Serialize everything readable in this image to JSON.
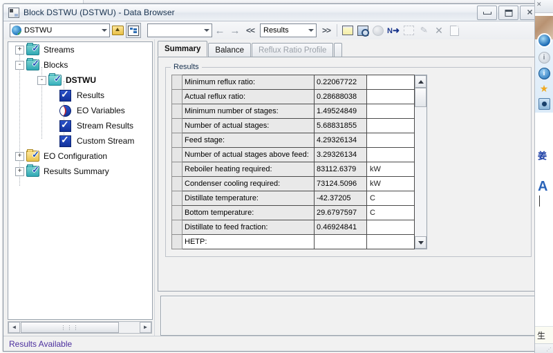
{
  "window": {
    "title": "Block DSTWU (DSTWU) - Data Browser",
    "icon": "application-icon",
    "minimize_label": "",
    "maximize_label": "",
    "close_label": "✕"
  },
  "toolbar": {
    "object_combo_value": "DSTWU",
    "object_combo_icon": "block-object-icon",
    "blank_combo_value": "",
    "folder_up_label": "folder-up-icon",
    "tree_toggle_label": "tree-view-icon",
    "back_arrow": "←",
    "forward_arrow": "→",
    "prev_chevrons": "<<",
    "next_chevrons": ">>",
    "form_combo_value": "Results",
    "icons": [
      {
        "name": "yellow-pane-icon",
        "label": ""
      },
      {
        "name": "magnify-input-icon",
        "label": ""
      },
      {
        "name": "globe-icon",
        "label": ""
      },
      {
        "name": "next-input-icon",
        "label": "N"
      },
      {
        "name": "dashed-box-icon",
        "label": ""
      },
      {
        "name": "pencil-icon",
        "label": "✎"
      },
      {
        "name": "delete-x-icon",
        "label": "✕"
      },
      {
        "name": "document-icon",
        "label": ""
      }
    ]
  },
  "tree": {
    "nodes": [
      {
        "label": "Streams",
        "icon": "folder-check-teal",
        "expander": "+",
        "indent": 0,
        "bold": false
      },
      {
        "label": "Blocks",
        "icon": "folder-check-teal",
        "expander": "-",
        "indent": 0,
        "bold": false
      },
      {
        "label": "DSTWU",
        "icon": "folder-check-teal",
        "expander": "-",
        "indent": 1,
        "bold": true
      },
      {
        "label": "Results",
        "icon": "blue-check",
        "expander": "",
        "indent": 2,
        "bold": false
      },
      {
        "label": "EO Variables",
        "icon": "half-moon",
        "expander": "",
        "indent": 2,
        "bold": false
      },
      {
        "label": "Stream Results",
        "icon": "blue-check",
        "expander": "",
        "indent": 2,
        "bold": false
      },
      {
        "label": "Custom Stream",
        "icon": "blue-check",
        "expander": "",
        "indent": 2,
        "bold": false
      },
      {
        "label": "EO Configuration",
        "icon": "folder-check-yellow",
        "expander": "+",
        "indent": 0,
        "bold": false
      },
      {
        "label": "Results Summary",
        "icon": "folder-check-teal",
        "expander": "+",
        "indent": 0,
        "bold": false
      }
    ],
    "hscroll": {
      "left_arrow": "◄",
      "right_arrow": "►",
      "grip": "⋮⋮⋮"
    }
  },
  "tabs": [
    {
      "label": "Summary",
      "state": "active"
    },
    {
      "label": "Balance",
      "state": "normal"
    },
    {
      "label": "Reflux Ratio Profile",
      "state": "disabled"
    }
  ],
  "results_group": {
    "title": "Results",
    "rows": [
      {
        "label": "Minimum reflux ratio:",
        "value": "0.22067722",
        "unit": "",
        "editable": false
      },
      {
        "label": "Actual reflux ratio:",
        "value": "0.28688038",
        "unit": "",
        "editable": false
      },
      {
        "label": "Minimum number of stages:",
        "value": "1.49524849",
        "unit": "",
        "editable": false
      },
      {
        "label": "Number of actual stages:",
        "value": "5.68831855",
        "unit": "",
        "editable": false
      },
      {
        "label": "Feed stage:",
        "value": "4.29326134",
        "unit": "",
        "editable": false
      },
      {
        "label": "Number of actual stages above feed:",
        "value": "3.29326134",
        "unit": "",
        "editable": false
      },
      {
        "label": "Reboiler heating required:",
        "value": "83112.6379",
        "unit": "kW",
        "editable": false
      },
      {
        "label": "Condenser cooling required:",
        "value": "73124.5096",
        "unit": "kW",
        "editable": false
      },
      {
        "label": "Distillate temperature:",
        "value": "-42.37205",
        "unit": "C",
        "editable": false
      },
      {
        "label": "Bottom temperature:",
        "value": "29.6797597",
        "unit": "C",
        "editable": false
      },
      {
        "label": "Distillate to feed fraction:",
        "value": "0.46924841",
        "unit": "",
        "editable": false
      },
      {
        "label": "HETP:",
        "value": "",
        "unit": "",
        "editable": true
      }
    ],
    "scrollbar": {
      "up": "▲",
      "down": "▼"
    }
  },
  "status_bar": {
    "text": "Results Available"
  },
  "side_window": {
    "close_glyph": "✕",
    "info_glyph": "i",
    "blue_info_glyph": "i",
    "star_glyph": "★",
    "camera_glyph": "",
    "cjk_name": "姜",
    "big_letter": "A",
    "bottom_text": "生"
  },
  "colors": {
    "status_text": "#4b2f9e",
    "title_text": "#18324f",
    "tree_check_blue": "#12329b",
    "folder_teal": "#2fa8b4",
    "folder_yellow": "#e7c24c",
    "grid_border": "#4a4a4a"
  }
}
